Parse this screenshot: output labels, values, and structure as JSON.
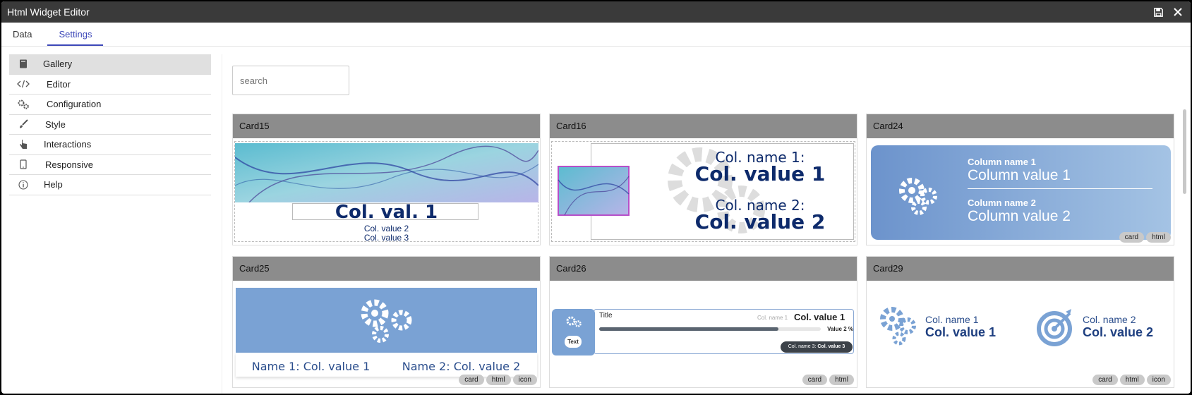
{
  "window": {
    "title": "Html Widget Editor"
  },
  "tabs": [
    {
      "label": "Data"
    },
    {
      "label": "Settings"
    }
  ],
  "sidebar": {
    "items": [
      {
        "label": "Gallery",
        "icon": "book-icon"
      },
      {
        "label": "Editor",
        "icon": "code-icon"
      },
      {
        "label": "Configuration",
        "icon": "gears-icon"
      },
      {
        "label": "Style",
        "icon": "brush-icon"
      },
      {
        "label": "Interactions",
        "icon": "pointer-hand-icon"
      },
      {
        "label": "Responsive",
        "icon": "mobile-icon"
      },
      {
        "label": "Help",
        "icon": "info-icon"
      }
    ]
  },
  "gallery": {
    "search_placeholder": "search",
    "cards": [
      {
        "title": "Card15",
        "big": "Col. val. 1",
        "small1": "Col. value 2",
        "small2": "Col. value 3",
        "tags": []
      },
      {
        "title": "Card16",
        "name1": "Col. name 1:",
        "value1": "Col. value 1",
        "name2": "Col. name 2:",
        "value2": "Col. value 2",
        "tags": []
      },
      {
        "title": "Card24",
        "name1": "Column name 1",
        "value1": "Column value 1",
        "name2": "Column name 2",
        "value2": "Column value 2",
        "tags": [
          "card",
          "html"
        ]
      },
      {
        "title": "Card25",
        "left": "Name 1: Col. value 1",
        "right": "Name 2: Col. value 2",
        "tags": [
          "card",
          "html",
          "icon"
        ]
      },
      {
        "title": "Card26",
        "chip": "Text",
        "heading": "Title",
        "name1": "Col. name 1",
        "value1": "Col. value 1",
        "value2": "Value 2 %",
        "name3": "Col. name 3:",
        "value3": "Col. value 3",
        "progress": 0.81,
        "tags": [
          "card",
          "html"
        ]
      },
      {
        "title": "Card29",
        "name1": "Col. name 1",
        "value1": "Col. value 1",
        "name2": "Col. name 2",
        "value2": "Col. value 2",
        "tags": [
          "card",
          "html",
          "icon"
        ]
      }
    ]
  },
  "colors": {
    "accent": "#3c47b8",
    "titlebar": "#3a3a3a",
    "card_header": "#8c8c8c",
    "navy": "#0d2a6b",
    "card_blue": "#7aa2d4"
  }
}
